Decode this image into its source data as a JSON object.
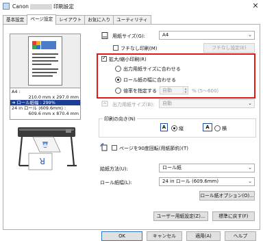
{
  "window": {
    "title_prefix": "Canon",
    "title_suffix": "印刷設定",
    "close_glyph": "✕"
  },
  "tabs": [
    "基本設定",
    "ページ設定",
    "レイアウト",
    "お気に入り",
    "ユーティリティ"
  ],
  "preview": {
    "info_lines": [
      "A4 :",
      "210.0 mm x 297.0 mm",
      "➜ ロール紙幅 : 299%",
      "24 in ロール (609.6mm) :",
      "609.6 mm x 870.4 mm"
    ]
  },
  "page_size": {
    "label": "用紙サイズ(G):",
    "value": "A4"
  },
  "borderless": {
    "label": "フチなし印刷(M)",
    "button": "フチなし設定(E)",
    "checked": false
  },
  "scaling": {
    "label": "拡大/縮小印刷(R)",
    "checked": true,
    "options": [
      "出力用紙サイズに合わせる",
      "ロール紙の幅に合わせる",
      "倍率を指定する"
    ],
    "selected_index": 1,
    "scale_value": "自動",
    "scale_range": "% (5〜600)"
  },
  "output_size": {
    "label": "出力用紙サイズ(B):",
    "value": "自動"
  },
  "orientation": {
    "group_label": "印刷の向き(N)",
    "portrait_label": "縦",
    "landscape_label": "横",
    "portrait_glyph": "A",
    "landscape_glyph": "A",
    "selected": "portrait"
  },
  "rotate90": {
    "label": "ページを90度回転(用紙節約)(T)",
    "checked": false
  },
  "paper_source": {
    "label": "給紙方法(U):",
    "value": "ロール紙"
  },
  "roll_width": {
    "label": "ロール紙幅(L):",
    "value": "24 in ロール (609.6mm)"
  },
  "buttons": {
    "roll_options": "ロール紙オプション(O)...",
    "user_paper": "ユーザー用紙設定(Z)...",
    "defaults": "標準に戻す(F)",
    "ok": "OK",
    "cancel": "キャンセル",
    "apply": "適用(A)",
    "help": "ヘルプ"
  }
}
